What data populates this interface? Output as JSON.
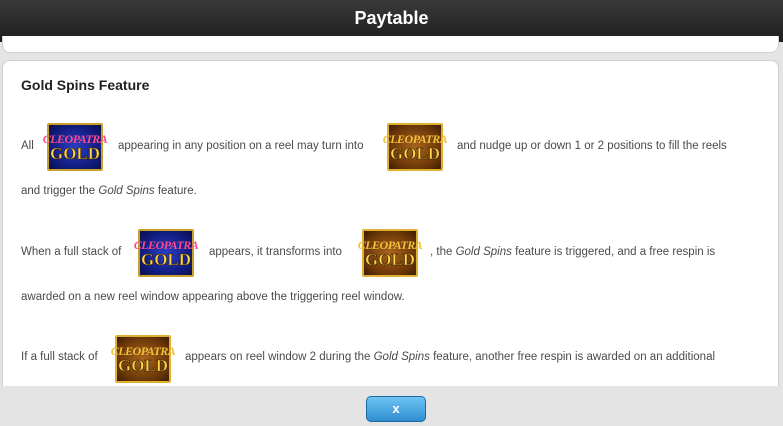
{
  "header": {
    "title": "Paytable"
  },
  "section": {
    "title": "Gold Spins Feature",
    "p1": {
      "a": "All",
      "b": "appearing in any position on a reel may turn into",
      "c": "and nudge up or down 1 or 2 positions to fill the reels",
      "d": "and trigger the",
      "e": "Gold Spins",
      "f": "feature."
    },
    "p2": {
      "a": "When a full stack of",
      "b": "appears, it transforms into",
      "c": ", the",
      "d": "Gold Spins",
      "e": "feature is triggered, and a free respin is",
      "f": "awarded on a new reel window appearing above the triggering reel window."
    },
    "p3": {
      "a": "If a full stack of",
      "b": "appears on reel window 2 during the",
      "c": "Gold Spins",
      "d": "feature, another free respin is awarded on an additional"
    }
  },
  "symbols": {
    "blue": {
      "line1": "CLEOPATRA",
      "line2": "GOLD",
      "color": "#1a2a9c"
    },
    "gold": {
      "line1": "CLEOPATRA",
      "line2": "GOLD",
      "color": "#7a4210"
    }
  },
  "footer": {
    "close_label": "x"
  }
}
